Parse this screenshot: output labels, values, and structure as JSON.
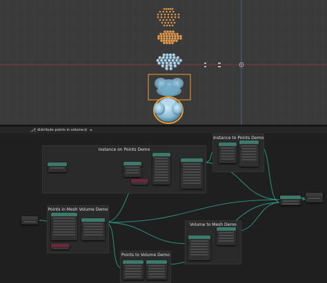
{
  "colors": {
    "viewport_bg": "#3a3a3a",
    "editor_bg": "#1f1f1f",
    "link": "#2e9e86",
    "geometry_header": "#3b7a6d",
    "input_header": "#6c2838",
    "point_orange": "#e39a4b",
    "sphere_blue": "#8fbad4",
    "selection": "#f0a030"
  },
  "viewport": {
    "icons": [
      "vertex-dot-icon",
      "edge-icon",
      "cursor-circle-icon"
    ]
  },
  "editor": {
    "header": {
      "icon_left": "node-tree-icon",
      "tree_name": "distribute points in volume",
      "close_icon": "close-icon",
      "pin_icon": "pin-icon"
    },
    "frames": [
      {
        "label": "Instance on Points Demo"
      },
      {
        "label": "Instance to Points Demo"
      },
      {
        "label": "Points in Mesh Volume Demo"
      },
      {
        "label": "Volume to Mesh Demo"
      },
      {
        "label": "Points to Volume Demo"
      }
    ]
  }
}
